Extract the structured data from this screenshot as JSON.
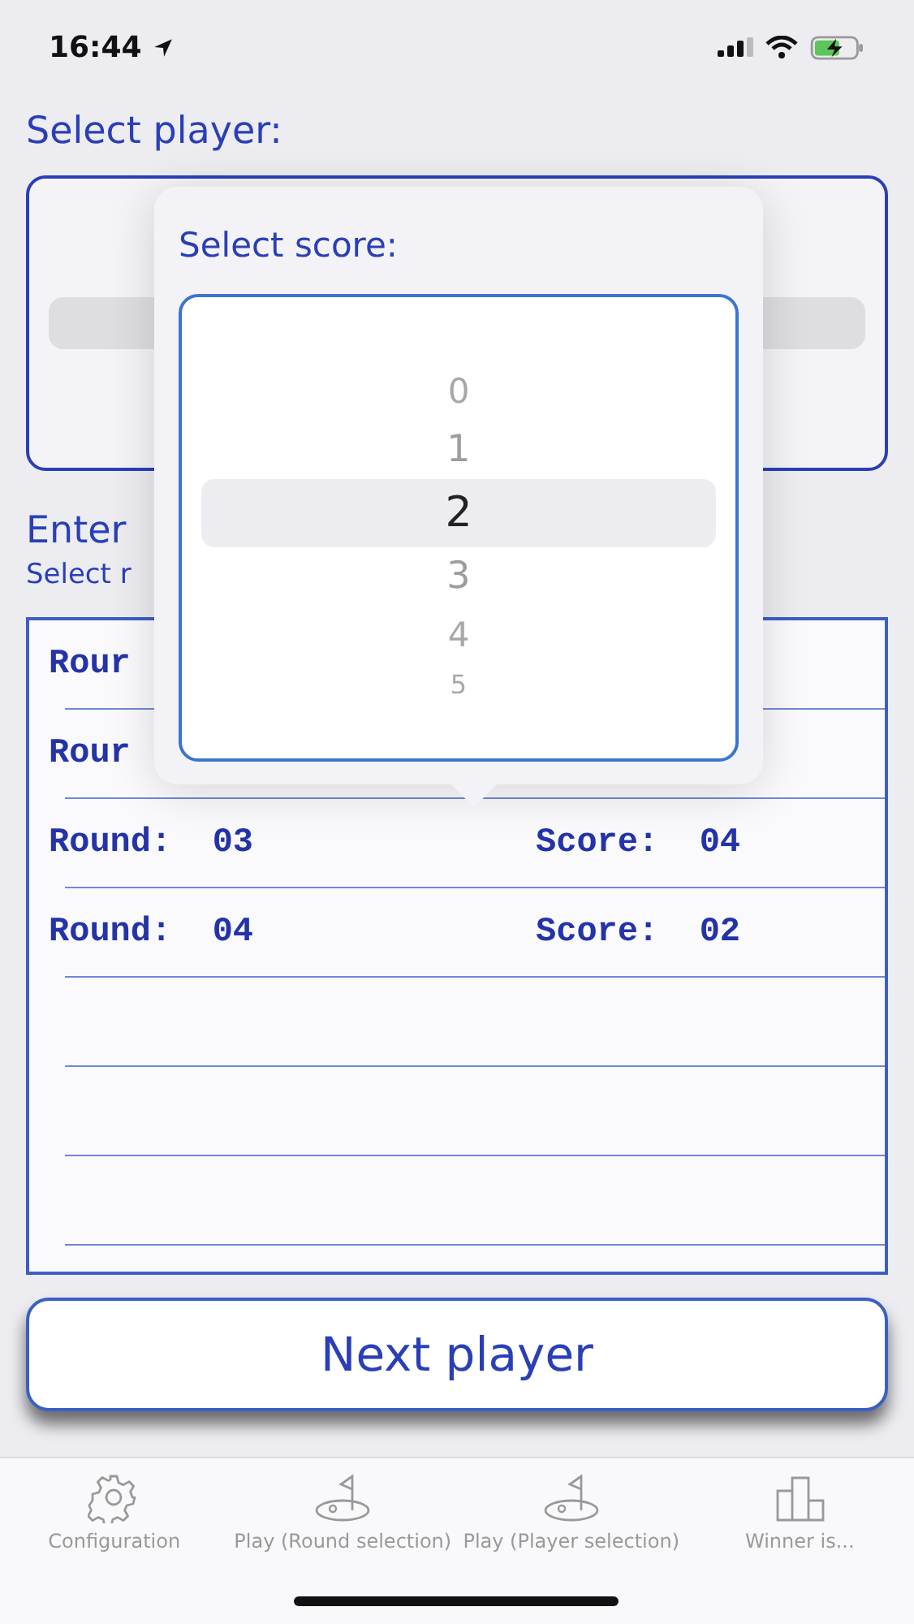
{
  "status_bar": {
    "time": "16:44"
  },
  "player_section": {
    "title": "Select player:"
  },
  "score_section": {
    "title": "Enter",
    "subtitle": "Select r"
  },
  "rounds": [
    {
      "round": "Rour"
    },
    {
      "round": "Rour"
    },
    {
      "round": "Round:  03",
      "score": "Score:  04"
    },
    {
      "round": "Round:  04",
      "score": "Score:  02"
    }
  ],
  "score_popover": {
    "title": "Select score:",
    "options": [
      {
        "label": "0",
        "selected": false
      },
      {
        "label": "1",
        "selected": false
      },
      {
        "label": "2",
        "selected": true
      },
      {
        "label": "3",
        "selected": false
      },
      {
        "label": "4",
        "selected": false
      },
      {
        "label": "5",
        "selected": false
      }
    ]
  },
  "next_button": "Next player",
  "tabs": [
    {
      "kind": "gear",
      "label": "Configuration",
      "selected": false
    },
    {
      "kind": "flag",
      "label": "Play (Round selection)",
      "selected": false
    },
    {
      "kind": "flag",
      "label": "Play (Player selection)",
      "selected": false
    },
    {
      "kind": "podium",
      "label": "Winner is...",
      "selected": false
    }
  ]
}
